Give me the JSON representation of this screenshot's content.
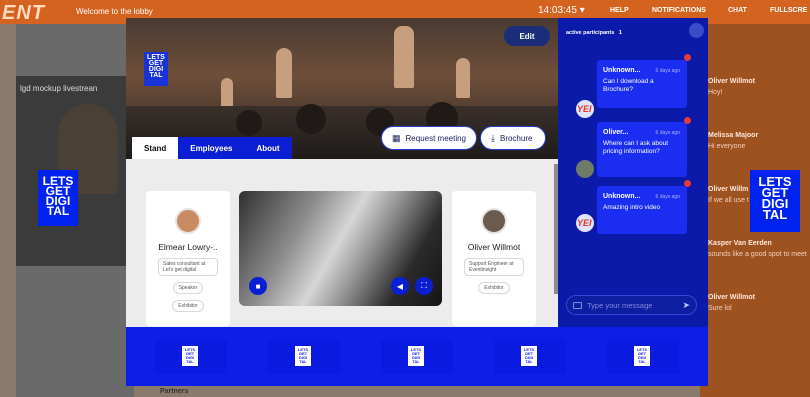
{
  "lobby": {
    "brand": "ENT",
    "welcome": "Welcome to the lobby",
    "clock": "14:03:45",
    "nav": [
      "HELP",
      "NOTIFICATIONS",
      "CHAT",
      "FULLSCRE"
    ],
    "stream_label": "lgd mockup livestrean",
    "bottom_label": "Partners",
    "side_messages": [
      {
        "name": "Oliver Willmot",
        "time": "6 days ago",
        "text": "Hoy!"
      },
      {
        "name": "Melissa Majoor",
        "time": "6 days ago",
        "text": "Hi everyone"
      },
      {
        "name": "Oliver Willm",
        "time": "",
        "text": "If we all use t"
      },
      {
        "name": "Kasper Van Eerden",
        "time": "6 days",
        "text": "sounds like a good spot to meet"
      },
      {
        "name": "Oliver Willmot",
        "time": "6 days ago",
        "text": "Sure lol"
      }
    ],
    "logo_text": [
      "LETS",
      "GET",
      "DIGI",
      "TAL"
    ]
  },
  "modal": {
    "edit_label": "Edit",
    "request_meeting_label": "Request meeting",
    "brochure_label": "Brochure",
    "tabs": [
      {
        "label": "Stand",
        "active": true
      },
      {
        "label": "Employees",
        "active": false
      },
      {
        "label": "About",
        "active": false
      }
    ],
    "employees": [
      {
        "name": "Elmear Lowry-..",
        "role": "Sales consultant at Let's get digital",
        "tags": [
          "Speaker",
          "Exhibitor"
        ]
      },
      {
        "name": "Oliver Willmot",
        "role": "Support Engineer at Eventinsight",
        "tags": [
          "Exhibitor"
        ]
      }
    ],
    "logo_count": 5,
    "accent": "#0a1fd4"
  },
  "chat": {
    "header": "active participants",
    "participant_count": "1",
    "messages": [
      {
        "name": "Unknown...",
        "time": "6 days ago",
        "text": "Can I download a Brochure?"
      },
      {
        "name": "Oliver...",
        "time": "6 days ago",
        "text": "Where can I ask about pricing information?"
      },
      {
        "name": "Unknown...",
        "time": "6 days ago",
        "text": "Amazing intro video"
      }
    ],
    "input_placeholder": "Type your message"
  }
}
